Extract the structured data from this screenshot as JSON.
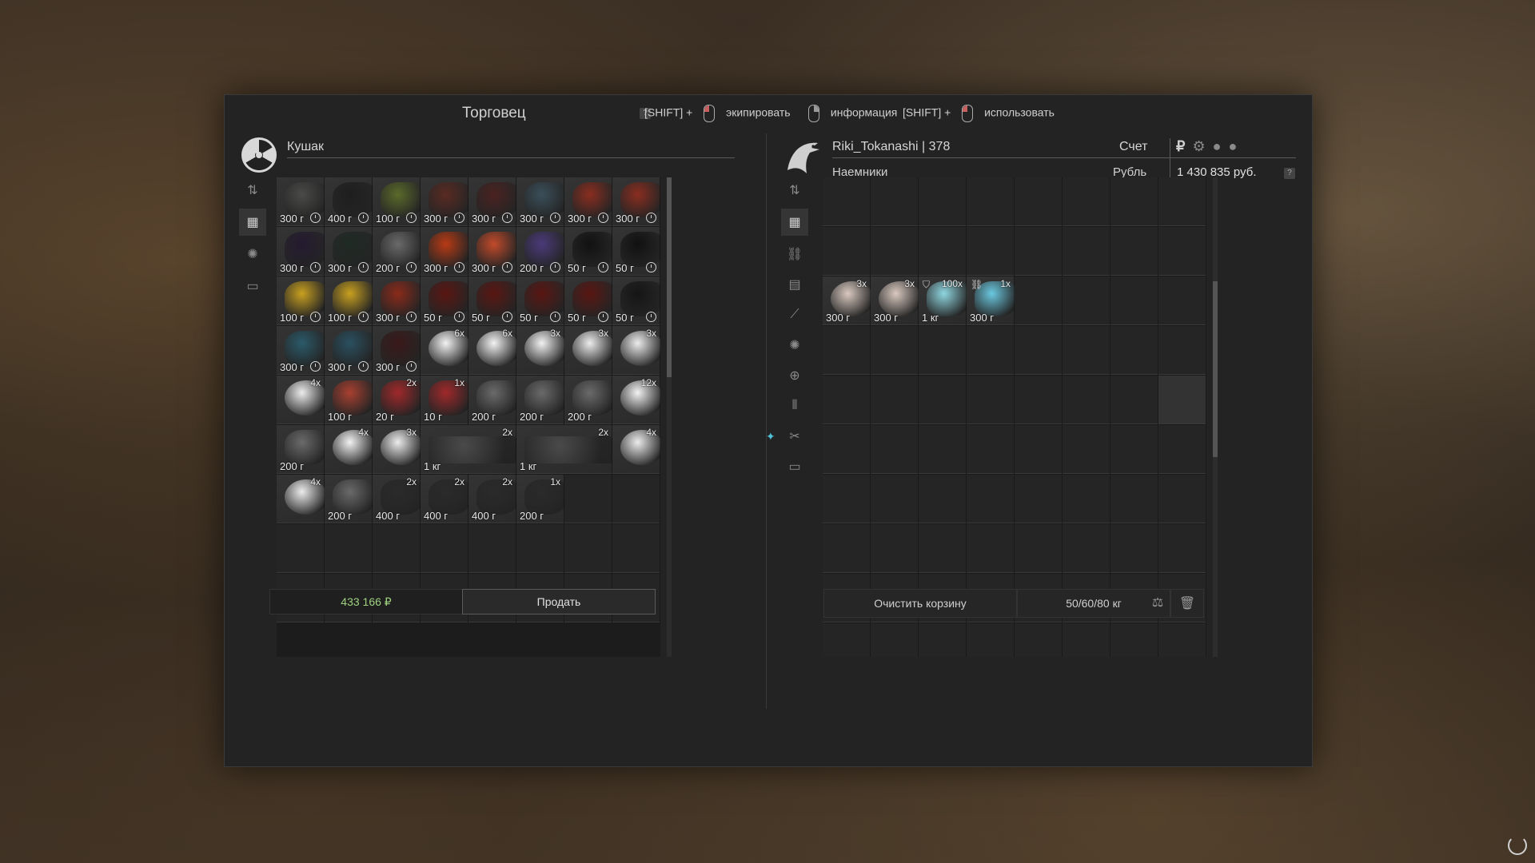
{
  "title": "Торговец",
  "help_mark": "?",
  "hints": [
    {
      "prefix": "[SHIFT] +",
      "label": "экипировать",
      "button": "left"
    },
    {
      "prefix": "",
      "label": "информация",
      "button": "right"
    },
    {
      "prefix": "[SHIFT] +",
      "label": "использовать",
      "button": "left"
    }
  ],
  "trader": {
    "name": "Кушак"
  },
  "player": {
    "name": "Riki_Tokanashi | 378",
    "faction": "Наемники",
    "account_label": "Счет",
    "currency_label": "Рубль",
    "currency_icon": "₽",
    "balance": "1 430 835 руб."
  },
  "trader_items": [
    {
      "price": "300 г",
      "timer": true,
      "color": "#4a4a48"
    },
    {
      "price": "400 г",
      "timer": true,
      "color": "#1e1e1e"
    },
    {
      "price": "100 г",
      "timer": true,
      "color": "#5b6a2a"
    },
    {
      "price": "300 г",
      "timer": true,
      "color": "#5a2a22"
    },
    {
      "price": "300 г",
      "timer": true,
      "color": "#4a2220"
    },
    {
      "price": "300 г",
      "timer": true,
      "color": "#3a4f5a"
    },
    {
      "price": "300 г",
      "timer": true,
      "color": "#8a2d1f"
    },
    {
      "price": "300 г",
      "timer": true,
      "color": "#8a2d1f"
    },
    {
      "price": "300 г",
      "timer": true,
      "color": "#241a30"
    },
    {
      "price": "300 г",
      "timer": true,
      "color": "#1e2a24"
    },
    {
      "price": "200 г",
      "timer": true,
      "color": "#6a6a6a"
    },
    {
      "price": "300 г",
      "timer": true,
      "color": "#b83a14"
    },
    {
      "price": "300 г",
      "timer": true,
      "color": "#c24a2a"
    },
    {
      "price": "200 г",
      "timer": true,
      "color": "#4a3a7a"
    },
    {
      "price": "50 г",
      "timer": true,
      "color": "#111111"
    },
    {
      "price": "50 г",
      "timer": true,
      "color": "#111111"
    },
    {
      "price": "100 г",
      "timer": true,
      "color": "#c8a020"
    },
    {
      "price": "100 г",
      "timer": true,
      "color": "#c8a020"
    },
    {
      "price": "300 г",
      "timer": true,
      "color": "#8a2a1a"
    },
    {
      "price": "50 г",
      "timer": true,
      "color": "#5a1612"
    },
    {
      "price": "50 г",
      "timer": true,
      "color": "#5a1612"
    },
    {
      "price": "50 г",
      "timer": true,
      "color": "#5a1612"
    },
    {
      "price": "50 г",
      "timer": true,
      "color": "#5a1612"
    },
    {
      "price": "50 г",
      "timer": true,
      "color": "#151515"
    },
    {
      "price": "300 г",
      "timer": true,
      "color": "#2a5a6a"
    },
    {
      "price": "300 г",
      "timer": true,
      "color": "#2a5060"
    },
    {
      "price": "300 г",
      "timer": true,
      "color": "#3a1818"
    },
    {
      "qty": "6x",
      "color": "#f2f2f2"
    },
    {
      "qty": "6x",
      "color": "#f2f2f2"
    },
    {
      "qty": "3x",
      "color": "#f2f2f2"
    },
    {
      "qty": "3x",
      "color": "#ececec"
    },
    {
      "qty": "3x",
      "color": "#ececec"
    },
    {
      "qty": "4x",
      "color": "#ececec"
    },
    {
      "price": "100 г",
      "color": "#a84030"
    },
    {
      "price": "20 г",
      "qty": "2x",
      "color": "#a0282a"
    },
    {
      "price": "10 г",
      "qty": "1x",
      "color": "#a0282a"
    },
    {
      "price": "200 г",
      "color": "#6a6a6a"
    },
    {
      "price": "200 г",
      "color": "#6a6a6a"
    },
    {
      "price": "200 г",
      "color": "#6a6a6a"
    },
    {
      "qty": "12x",
      "color": "#f2f2f2"
    },
    {
      "price": "200 г",
      "color": "#6a6a6a"
    },
    {
      "qty": "4x",
      "color": "#f2f2f2"
    },
    {
      "qty": "3x",
      "color": "#ececec"
    },
    {
      "price": "1 кг",
      "qty": "2x",
      "color": "#4a4a4a",
      "wide": true
    },
    null,
    {
      "price": "1 кг",
      "qty": "2x",
      "color": "#4a4a4a",
      "wide": true
    },
    null,
    {
      "qty": "4x",
      "color": "#ececec"
    },
    {
      "qty": "4x",
      "color": "#ececec"
    },
    {
      "price": "200 г",
      "color": "#6a6a6a"
    },
    {
      "price": "400 г",
      "qty": "2x",
      "color": "#2a2a2a"
    },
    {
      "price": "400 г",
      "qty": "2x",
      "color": "#2a2a2a"
    },
    {
      "price": "400 г",
      "qty": "2x",
      "color": "#2a2a2a"
    },
    {
      "price": "200 г",
      "qty": "1x",
      "color": "#2a2a2a"
    },
    {
      "empty": true
    },
    {
      "empty": true
    }
  ],
  "cart_items": [
    {
      "price": "300 г",
      "qty": "3x",
      "color": "#d9c9c0"
    },
    {
      "price": "300 г",
      "qty": "3x",
      "color": "#d9c9c0"
    },
    {
      "price": "1 кг",
      "qty": "100x",
      "color": "#8fd6e0",
      "badge": "shield-icon"
    },
    {
      "price": "300 г",
      "qty": "1x",
      "color": "#6ac8e0",
      "badge": "link-icon"
    }
  ],
  "footer": {
    "money": "433 166 ₽",
    "sell": "Продать",
    "clear": "Очистить корзину",
    "weight": "50/60/80 кг"
  }
}
